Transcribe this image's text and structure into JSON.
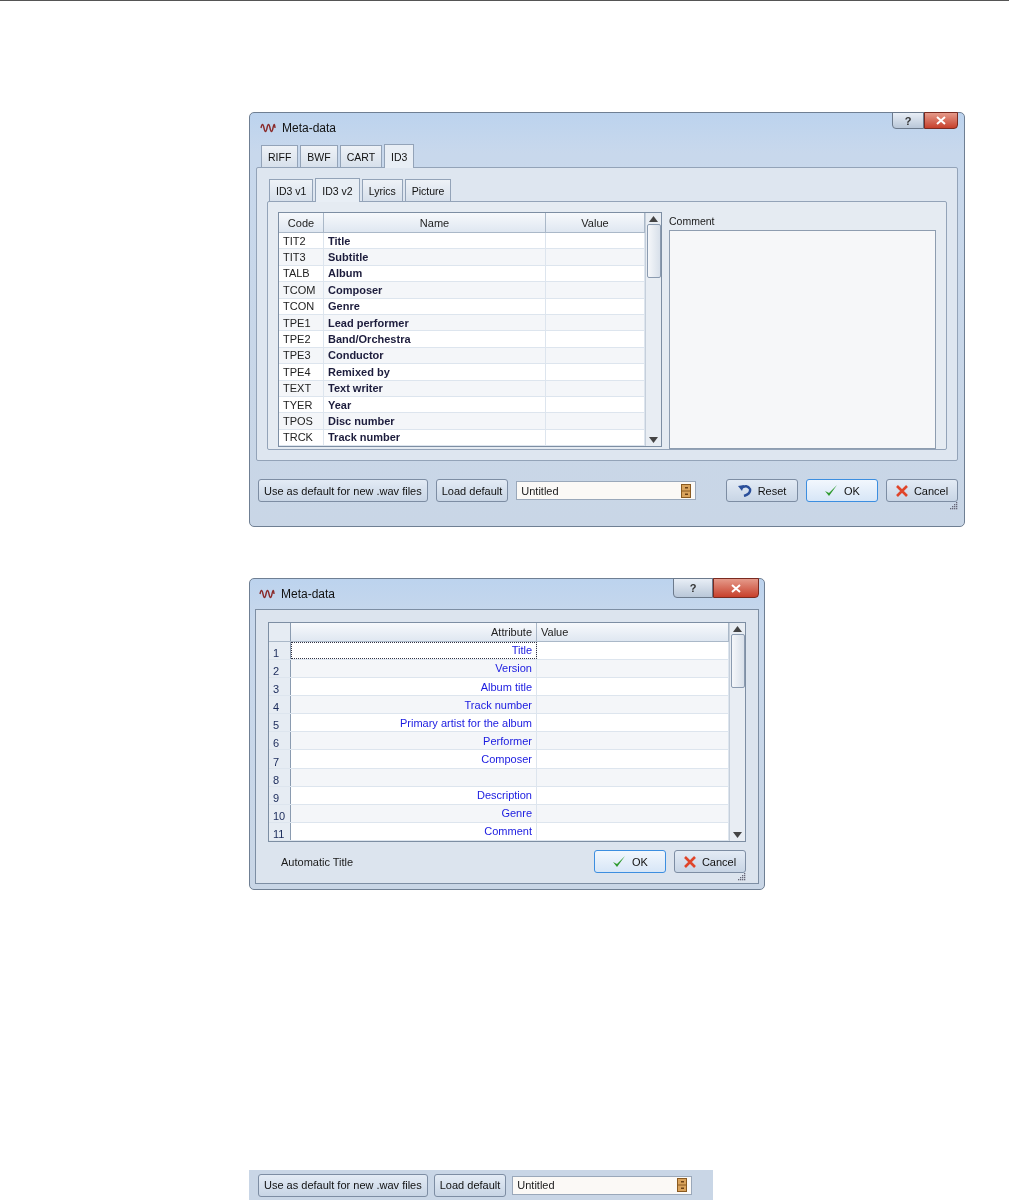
{
  "dialog_1": {
    "title": "Meta-data",
    "help_button": "?",
    "outer_tabs": [
      {
        "label": "RIFF",
        "selected": false
      },
      {
        "label": "BWF",
        "selected": false
      },
      {
        "label": "CART",
        "selected": false
      },
      {
        "label": "ID3",
        "selected": true
      }
    ],
    "inner_tabs": [
      {
        "label": "ID3 v1",
        "selected": false
      },
      {
        "label": "ID3 v2",
        "selected": true
      },
      {
        "label": "Lyrics",
        "selected": false
      },
      {
        "label": "Picture",
        "selected": false
      }
    ],
    "table": {
      "columns": [
        "Code",
        "Name",
        "Value"
      ],
      "rows": [
        {
          "code": "TIT2",
          "name": "Title"
        },
        {
          "code": "TIT3",
          "name": "Subtitle"
        },
        {
          "code": "TALB",
          "name": "Album"
        },
        {
          "code": "TCOM",
          "name": "Composer"
        },
        {
          "code": "TCON",
          "name": "Genre"
        },
        {
          "code": "TPE1",
          "name": "Lead performer"
        },
        {
          "code": "TPE2",
          "name": "Band/Orchestra"
        },
        {
          "code": "TPE3",
          "name": "Conductor"
        },
        {
          "code": "TPE4",
          "name": "Remixed by"
        },
        {
          "code": "TEXT",
          "name": "Text writer"
        },
        {
          "code": "TYER",
          "name": "Year"
        },
        {
          "code": "TPOS",
          "name": "Disc number"
        },
        {
          "code": "TRCK",
          "name": "Track number"
        }
      ]
    },
    "comment_label": "Comment",
    "footer": {
      "buttons": [
        {
          "label": "Use as default for new .wav files"
        },
        {
          "label": "Load default"
        }
      ],
      "preset_field": {
        "value": "Untitled"
      },
      "actions": [
        {
          "label": "Reset",
          "kind": "reset",
          "default": false
        },
        {
          "label": "OK",
          "kind": "ok",
          "default": true
        },
        {
          "label": "Cancel",
          "kind": "cancel",
          "default": false
        }
      ]
    }
  },
  "dialog_2": {
    "title": "Meta-data",
    "help_button": "?",
    "table": {
      "columns": [
        "Attribute",
        "Value"
      ],
      "rows": [
        {
          "number": "1",
          "attribute": "Title",
          "focused": true
        },
        {
          "number": "2",
          "attribute": "Version",
          "focused": false
        },
        {
          "number": "3",
          "attribute": "Album title",
          "focused": false
        },
        {
          "number": "4",
          "attribute": "Track number",
          "focused": false
        },
        {
          "number": "5",
          "attribute": "Primary artist for the album",
          "focused": false
        },
        {
          "number": "6",
          "attribute": "Performer",
          "focused": false
        },
        {
          "number": "7",
          "attribute": "Composer",
          "focused": false
        },
        {
          "number": "8",
          "focused": false
        },
        {
          "number": "9",
          "attribute": "Description",
          "focused": false
        },
        {
          "number": "10",
          "attribute": "Genre",
          "focused": false
        },
        {
          "number": "11",
          "attribute": "Comment",
          "focused": false
        }
      ]
    },
    "status": "Automatic Title",
    "actions": [
      {
        "label": "OK",
        "kind": "ok",
        "default": true
      },
      {
        "label": "Cancel",
        "kind": "cancel",
        "default": false
      }
    ]
  },
  "preset_strip": {
    "buttons": [
      {
        "label": "Use as default for new .wav files"
      },
      {
        "label": "Load default"
      }
    ],
    "preset_field": {
      "value": "Untitled"
    }
  }
}
